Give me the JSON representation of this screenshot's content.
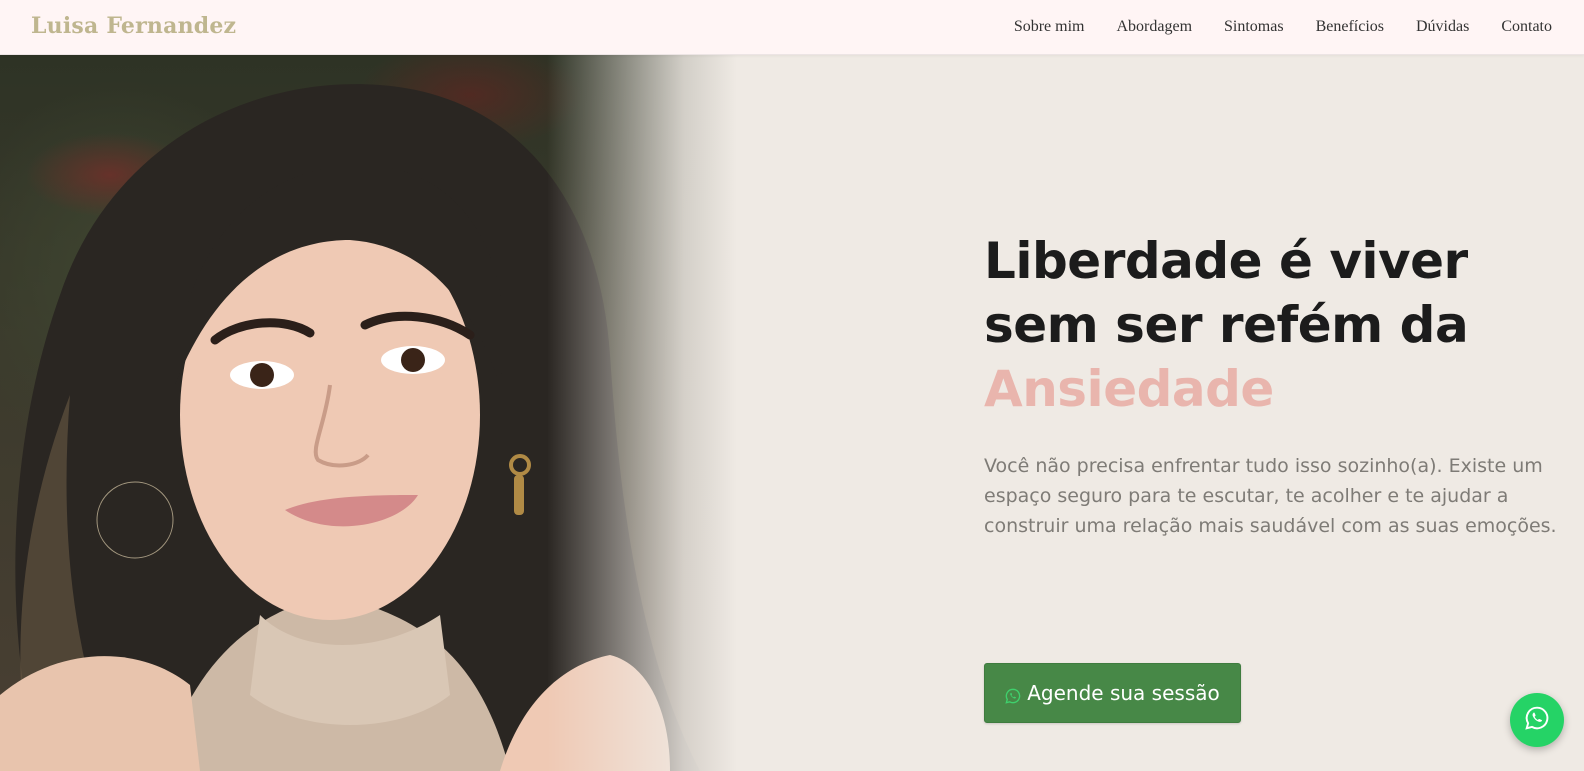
{
  "header": {
    "brand": "Luisa Fernandez",
    "nav": [
      "Sobre mim",
      "Abordagem",
      "Sintomas",
      "Benefícios",
      "Dúvidas",
      "Contato"
    ]
  },
  "hero": {
    "headline": "Liberdade é viver sem ser refém da",
    "headline_accent": "Ansiedade",
    "lead": "Você não precisa enfrentar tudo isso sozinho(a). Existe um espaço seguro para te escutar, te acolher e te ajudar a construir uma relação mais saudável com as suas emoções.",
    "cta": {
      "label": "Agende sua sessão",
      "icon": "whatsapp-icon"
    },
    "photo": {
      "icon": "portrait-photo"
    }
  },
  "floating_button": {
    "icon": "whatsapp-icon"
  },
  "colors": {
    "header_bg": "#fff5f5",
    "brand": "#bfb68f",
    "accent": "#e9b5ad",
    "hero_bg": "#efeae4",
    "cta_bg": "#478847",
    "whatsapp": "#25d366"
  }
}
